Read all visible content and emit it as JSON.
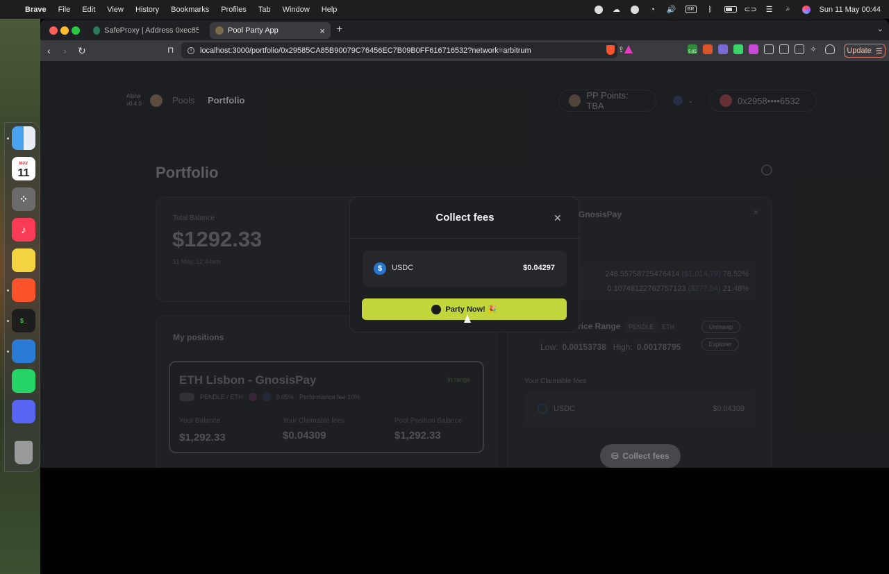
{
  "menubar": {
    "app": "Brave",
    "items": [
      "File",
      "Edit",
      "View",
      "History",
      "Bookmarks",
      "Profiles",
      "Tab",
      "Window",
      "Help"
    ],
    "datetime": "Sun 11 May  00:44",
    "keyboard": "BR"
  },
  "dock": {
    "calendar_month": "MAY",
    "calendar_day": "11"
  },
  "browser": {
    "tabs": [
      {
        "title": "SafeProxy | Address 0xec85aa8b"
      },
      {
        "title": "Pool Party App"
      }
    ],
    "url": "localhost:3000/portfolio/0x29585CA85B90079C76456EC7B09B0FF616716532?network=arbitrum",
    "extension_badge": "5.65",
    "update_label": "Update"
  },
  "nav": {
    "alpha_label": "Alpha",
    "version": "v0.4.0",
    "links": [
      "Pools",
      "Portfolio"
    ],
    "points": "PP Points: TBA",
    "wallet": "0x2958••••6532"
  },
  "portfolio": {
    "title": "Portfolio",
    "total_balance_label": "Total Balance",
    "total_balance": "$1292.33",
    "balance_time": "11 May, 12:44am",
    "positions_title": "My positions",
    "position": {
      "name": "ETH Lisbon - GnosisPay",
      "status": "In range",
      "pair": "PENDLE / ETH",
      "fee_tier": "0.05%",
      "performance_fee": "Performance fee 10%",
      "balance_label": "Your Balance",
      "balance": "$1,292.33",
      "claimable_label": "Your Claimable fees",
      "claimable": "$0.04309",
      "pool_label": "Pool Position Balance",
      "pool_balance": "$1,292.33"
    }
  },
  "detail": {
    "title_partial": "GnosisPay",
    "token_rows": [
      {
        "amount": "248.55758725476414",
        "usd": "($1,014.79)",
        "pct": "78.52%"
      },
      {
        "amount": "0.10748122762757123",
        "usd": "($277.54)",
        "pct": "21.48%"
      }
    ],
    "price_range_label": "rice Range",
    "chip_a": "PENDLE",
    "chip_b": "ETH",
    "low_label": "Low:",
    "low": "0.00153738",
    "high_label": "High:",
    "high": "0.00178795",
    "uniswap_label": "Uniswap",
    "explorer_label": "Explorer",
    "claimable_title": "Your Claimable fees",
    "claim_token": "USDC",
    "claim_amount": "$0.04309",
    "collect_label": "Collect fees"
  },
  "modal": {
    "title": "Collect fees",
    "close": "✕",
    "token": "USDC",
    "amount": "$0.04297",
    "button": "Party Now! 🎉"
  }
}
